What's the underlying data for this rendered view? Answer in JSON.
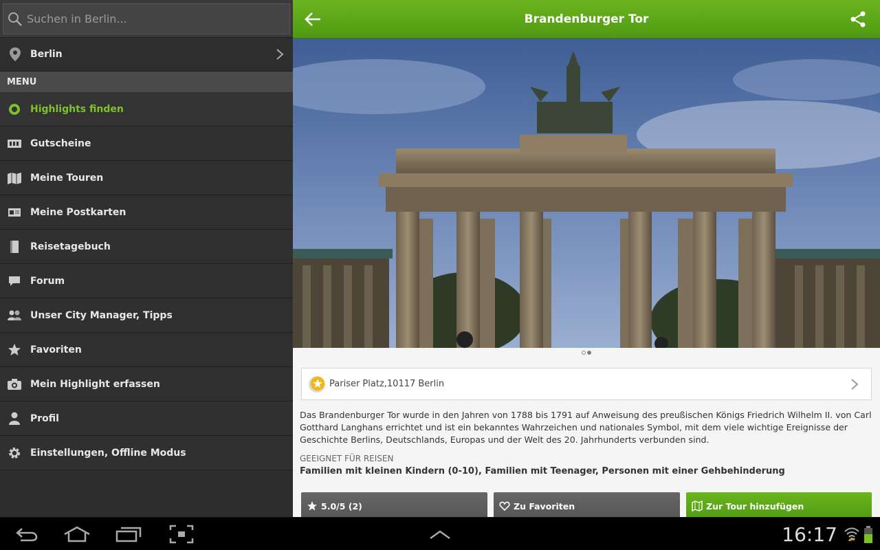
{
  "search": {
    "placeholder": "Suchen in Berlin..."
  },
  "city": {
    "label": "Berlin"
  },
  "menu": {
    "header": "MENU",
    "items": [
      {
        "label": "Highlights finden",
        "icon": "target-icon",
        "active": true
      },
      {
        "label": "Gutscheine",
        "icon": "ticket-icon"
      },
      {
        "label": "Meine Touren",
        "icon": "map-icon"
      },
      {
        "label": "Meine Postkarten",
        "icon": "postcard-icon"
      },
      {
        "label": "Reisetagebuch",
        "icon": "book-icon"
      },
      {
        "label": "Forum",
        "icon": "chat-icon"
      },
      {
        "label": "Unser City Manager, Tipps",
        "icon": "people-icon"
      },
      {
        "label": "Favoriten",
        "icon": "star-icon"
      },
      {
        "label": "Mein Highlight erfassen",
        "icon": "camera-icon"
      },
      {
        "label": "Profil",
        "icon": "person-icon"
      },
      {
        "label": "Einstellungen, Offline Modus",
        "icon": "gear-icon"
      }
    ]
  },
  "detail": {
    "title": "Brandenburger Tor",
    "address": "Pariser Platz,10117 Berlin",
    "description": "Das Brandenburger Tor wurde in den Jahren von 1788 bis 1791 auf Anweisung des preußischen Königs Friedrich Wilhelm II. von Carl Gotthard Langhans errichtet und ist ein bekanntes Wahrzeichen und nationales Symbol, mit dem viele wichtige Ereignisse der Geschichte Berlins, Deutschlands, Europas und der Welt des 20. Jahrhunderts verbunden sind.",
    "suitable_heading": "GEEIGNET FÜR REISEN",
    "suitable_value": "Familien mit kleinen Kindern (0-10), Familien mit Teenager, Personen mit einer Gehbehinderung",
    "rating_label": "5.0/5 (2)",
    "favorite_label": "Zu Favoriten",
    "tour_label": "Zur Tour hinzufügen"
  },
  "gallery": {
    "current_page": 2,
    "total_pages": 2
  },
  "statusbar": {
    "time": "16:17"
  },
  "colors": {
    "accent": "#6bb51f",
    "sidebar": "#2d2d2d"
  }
}
